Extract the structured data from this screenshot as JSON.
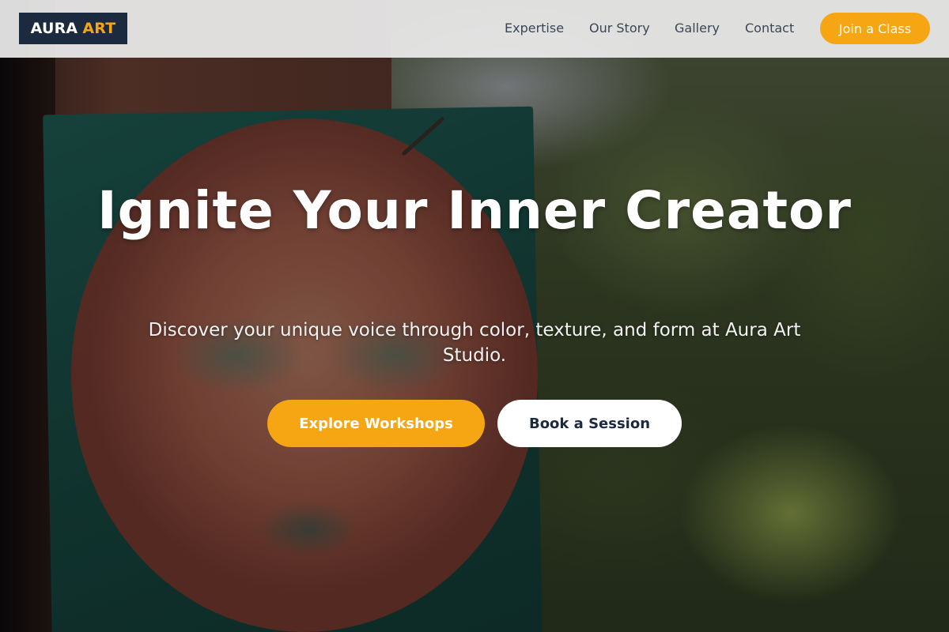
{
  "brand": {
    "logo_primary": "AURA",
    "logo_accent": "ART",
    "accent_color": "#f6a513",
    "dark_color": "#1c2a40"
  },
  "nav": {
    "items": [
      {
        "label": "Expertise"
      },
      {
        "label": "Our Story"
      },
      {
        "label": "Gallery"
      },
      {
        "label": "Contact"
      }
    ],
    "cta_label": "Join a Class"
  },
  "hero": {
    "title": "Ignite Your Inner Creator",
    "subtitle": "Discover your unique voice through color, texture, and form at Aura Art Studio.",
    "primary_button": "Explore Workshops",
    "secondary_button": "Book a Session"
  }
}
